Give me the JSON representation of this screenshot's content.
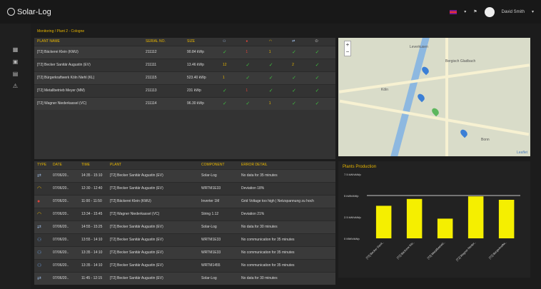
{
  "app": {
    "logo": "Solar-Log",
    "user": "David Smith"
  },
  "breadcrumb": "Monitoring / Plant 2 - Cologne",
  "plants": {
    "headers": [
      "PLANT NAME",
      "SERIAL NO.",
      "SIZE"
    ],
    "rows": [
      {
        "name": "[T2] Bäckerei Klein (KMU)",
        "serial": "211112",
        "size": "90.84 kWp",
        "c1": "✓",
        "c2": "1",
        "c3": "1",
        "c4": "✓",
        "c5": "✓"
      },
      {
        "name": "[T2] Becker Sanitär Augustin (EV)",
        "serial": "211111",
        "size": "13.46 kWp",
        "c1": "12",
        "c2": "✓",
        "c3": "✓",
        "c4": "2",
        "c5": "✓"
      },
      {
        "name": "[T2] Bürgerkraftwerk Köln Niehl (KL)",
        "serial": "211115",
        "size": "523.40 kWp",
        "c1": "1",
        "c2": "✓",
        "c3": "✓",
        "c4": "✓",
        "c5": "✓"
      },
      {
        "name": "[T2] Metallbetrieb Meyer (MM)",
        "serial": "211113",
        "size": "231 kWp",
        "c1": "✓",
        "c2": "1",
        "c3": "✓",
        "c4": "✓",
        "c5": "✓"
      },
      {
        "name": "[T2] Wagner Niederkassel (VC)",
        "serial": "211114",
        "size": "96.30 kWp",
        "c1": "✓",
        "c2": "✓",
        "c3": "1",
        "c4": "✓",
        "c5": "✓"
      }
    ]
  },
  "events": {
    "headers": [
      "TYPE",
      "DATE",
      "TIME",
      "PLANT",
      "COMPONENT",
      "ERROR DETAIL"
    ],
    "rows": [
      {
        "type": "share",
        "date": "07/06/20..",
        "time": "14:35 - 15:10",
        "plant": "[T2] Becker Sanitär Augustin (EV)",
        "component": "Solar-Log",
        "detail": "No data for 35 minutes"
      },
      {
        "type": "gauge",
        "date": "07/06/20..",
        "time": "12:30 - 12:40",
        "plant": "[T2] Becker Sanitär Augustin (EV)",
        "component": "WRTM1E33",
        "detail": "Deviation 18%"
      },
      {
        "type": "alert",
        "date": "07/06/20..",
        "time": "11:00 - 11:50",
        "plant": "[T2] Bäckerei Klein (KMU)",
        "component": "Inverter 1M",
        "detail": "Grid Voltage too high | Netzspannung zu hoch"
      },
      {
        "type": "gauge",
        "date": "07/06/20..",
        "time": "13:34 - 15:45",
        "plant": "[T2] Wagner Niederkassel (VC)",
        "component": "String 1.12",
        "detail": "Deviation 21%"
      },
      {
        "type": "share",
        "date": "07/06/20..",
        "time": "14:55 - 15:25",
        "plant": "[T2] Becker Sanitär Augustin (EV)",
        "component": "Solar-Log",
        "detail": "No data for 30 minutes"
      },
      {
        "type": "net",
        "date": "07/06/20..",
        "time": "13:55 - 14:10",
        "plant": "[T2] Becker Sanitär Augustin (EV)",
        "component": "WRTM1E33",
        "detail": "No communication for 35 minutes"
      },
      {
        "type": "net",
        "date": "07/06/20..",
        "time": "13:35 - 14:10",
        "plant": "[T2] Becker Sanitär Augustin (EV)",
        "component": "WRTM1E33",
        "detail": "No communication for 35 minutes"
      },
      {
        "type": "net",
        "date": "07/06/20..",
        "time": "13:35 - 14:10",
        "plant": "[T2] Becker Sanitär Augustin (EV)",
        "component": "WRTM1455",
        "detail": "No communication for 35 minutes"
      },
      {
        "type": "share",
        "date": "07/06/20..",
        "time": "11:45 - 12:15",
        "plant": "[T2] Becker Sanitär Augustin (EV)",
        "component": "Solar-Log",
        "detail": "No data for 30 minutes"
      }
    ]
  },
  "map": {
    "labels": [
      "Bergisch Gladbach",
      "Köln",
      "Bonn",
      "Leverkusen"
    ],
    "zoom_in": "+",
    "zoom_out": "−",
    "attribution": "Leaflet"
  },
  "chart_data": {
    "type": "bar",
    "title": "Plants Production",
    "categories": [
      "[T2] Becker Sanit..",
      "[T2] Bäckerei Kle..",
      "[T2] Metallbetrieb..",
      "[T2] Wagner Nieder..",
      "[T2] Bürgerkraftw.."
    ],
    "values": [
      3.8,
      4.6,
      2.3,
      4.9,
      4.5
    ],
    "reference": 5,
    "yticks": [
      "0 MWh/kWp",
      "2.5 kWh/kWp",
      "5 kWh/kWp",
      "7.5 kWh/kWp"
    ],
    "ylim": [
      0,
      7.5
    ],
    "bar_color": "#f5ef00"
  }
}
